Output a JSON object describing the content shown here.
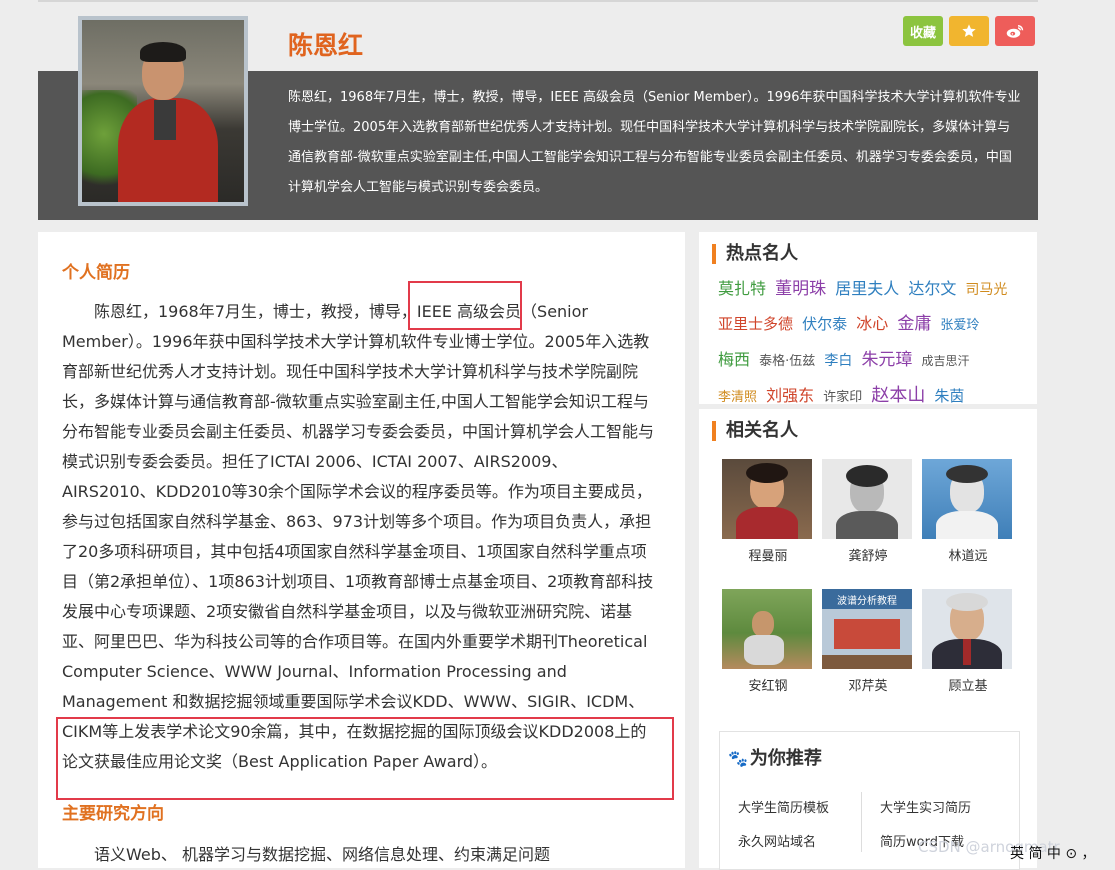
{
  "profile": {
    "name": "陈恩红",
    "summary": "陈恩红，1968年7月生，博士，教授，博导，IEEE 高级会员（Senior Member）。1996年获中国科学技术大学计算机软件专业博士学位。2005年入选教育部新世纪优秀人才支持计划。现任中国科学技术大学计算机科学与技术学院副院长，多媒体计算与通信教育部-微软重点实验室副主任,中国人工智能学会知识工程与分布智能专业委员会副主任委员、机器学习专委会委员，中国计算机学会人工智能与模式识别专委会委员。",
    "photo_icon": "portrait-photo"
  },
  "actions": {
    "favorite_label": "收藏",
    "star_icon": "star-icon",
    "weibo_icon": "weibo-icon"
  },
  "main": {
    "bio_title": "个人简历",
    "bio_text": "陈恩红，1968年7月生，博士，教授，博导，IEEE 高级会员（Senior Member）。1996年获中国科学技术大学计算机软件专业博士学位。2005年入选教育部新世纪优秀人才支持计划。现任中国科学技术大学计算机科学与技术学院副院长，多媒体计算与通信教育部-微软重点实验室副主任,中国人工智能学会知识工程与分布智能专业委员会副主任委员、机器学习专委会委员，中国计算机学会人工智能与模式识别专委会委员。担任了ICTAI 2006、ICTAI 2007、AIRS2009、AIRS2010、KDD2010等30余个国际学术会议的程序委员等。作为项目主要成员，参与过包括国家自然科学基金、863、973计划等多个项目。作为项目负责人，承担了20多项科研项目，其中包括4项国家自然科学基金项目、1项国家自然科学重点项目（第2承担单位）、1项863计划项目、1项教育部博士点基金项目、2项教育部科技发展中心专项课题、2项安徽省自然科学基金项目，以及与微软亚洲研究院、诺基亚、阿里巴巴、华为科技公司等的合作项目等。在国内外重要学术期刊Theoretical Computer Science、WWW Journal、Information Processing and Management 和数据挖掘领域重要国际学术会议KDD、WWW、SIGIR、ICDM、CIKM等上发表学术论文90余篇，其中，在数据挖掘的国际顶级会议KDD2008上的论文获最佳应用论文奖（Best Application Paper Award）。",
    "research_title": "主要研究方向",
    "research_text": "语义Web、 机器学习与数据挖掘、网络信息处理、约束满足问题"
  },
  "hot": {
    "title": "热点名人",
    "names": [
      {
        "text": "莫扎特",
        "color": "#3f9b3f",
        "size": 16
      },
      {
        "text": "董明珠",
        "color": "#8c3fa8",
        "size": 17
      },
      {
        "text": "居里夫人",
        "color": "#2f7fbf",
        "size": 16
      },
      {
        "text": "达尔文",
        "color": "#2f7fbf",
        "size": 16
      },
      {
        "text": "司马光",
        "color": "#d08b1e",
        "size": 14
      },
      {
        "text": "亚里士多德",
        "color": "#d0452b",
        "size": 15
      },
      {
        "text": "伏尔泰",
        "color": "#2f7fbf",
        "size": 15
      },
      {
        "text": "冰心",
        "color": "#d0452b",
        "size": 16
      },
      {
        "text": "金庸",
        "color": "#8c3fa8",
        "size": 17
      },
      {
        "text": "张爱玲",
        "color": "#2f7fbf",
        "size": 13
      },
      {
        "text": "梅西",
        "color": "#3f9b3f",
        "size": 16
      },
      {
        "text": "泰格·伍兹",
        "color": "#555555",
        "size": 13
      },
      {
        "text": "李白",
        "color": "#2f7fbf",
        "size": 14
      },
      {
        "text": "朱元璋",
        "color": "#8c3fa8",
        "size": 17
      },
      {
        "text": "成吉思汗",
        "color": "#555555",
        "size": 12
      },
      {
        "text": "李清照",
        "color": "#d08b1e",
        "size": 13
      },
      {
        "text": "刘强东",
        "color": "#d0452b",
        "size": 16
      },
      {
        "text": "许家印",
        "color": "#555555",
        "size": 13
      },
      {
        "text": "赵本山",
        "color": "#8c3fa8",
        "size": 18
      },
      {
        "text": "朱茵",
        "color": "#2f7fbf",
        "size": 15
      }
    ]
  },
  "related": {
    "title": "相关名人",
    "people": [
      {
        "name": "程曼丽",
        "icon": "portrait-photo"
      },
      {
        "name": "龚舒婷",
        "icon": "portrait-photo"
      },
      {
        "name": "林道远",
        "icon": "portrait-photo"
      },
      {
        "name": "安红钢",
        "icon": "portrait-photo"
      },
      {
        "name": "邓芹英",
        "icon": "book-cover"
      },
      {
        "name": "顾立基",
        "icon": "portrait-photo"
      }
    ],
    "book_title": "波谱分析教程"
  },
  "recommend": {
    "title": "为你推荐",
    "links": [
      "大学生简历模板",
      "大学生实习简历",
      "永久网站域名",
      "简历word下载"
    ]
  },
  "watermark": "CSDN @arnoqmatr",
  "taskbar_text": "英 简 中 ⊙ ，"
}
